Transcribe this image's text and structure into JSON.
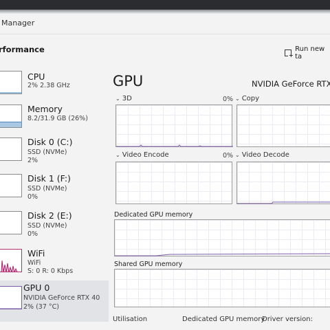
{
  "window": {
    "title": "Manager"
  },
  "header": {
    "section": "rformance",
    "run_new_task": "Run new ta"
  },
  "sidebar": {
    "items": [
      {
        "name": "CPU",
        "line2": "2% 2.38 GHz",
        "line3": ""
      },
      {
        "name": "Memory",
        "line2": "8.2/31.9 GB (26%)",
        "line3": ""
      },
      {
        "name": "Disk 0 (C:)",
        "line2": "SSD (NVMe)",
        "line3": "2%"
      },
      {
        "name": "Disk 1 (F:)",
        "line2": "SSD (NVMe)",
        "line3": "0%"
      },
      {
        "name": "Disk 2 (E:)",
        "line2": "SSD (NVMe)",
        "line3": "0%"
      },
      {
        "name": "WiFi",
        "line2": "WiFi",
        "line3": "S: 0 R: 0 Kbps"
      },
      {
        "name": "GPU 0",
        "line2": "NVIDIA GeForce RTX 40",
        "line3": "2% (37 °C)"
      }
    ]
  },
  "main": {
    "title": "GPU",
    "model": "NVIDIA GeForce RTX",
    "engines": [
      {
        "label": "3D",
        "percent": "0%"
      },
      {
        "label": "Copy",
        "percent": ""
      },
      {
        "label": "Video Encode",
        "percent": "0%"
      },
      {
        "label": "Video Decode",
        "percent": ""
      }
    ],
    "dedicated_memory_label": "Dedicated GPU memory",
    "shared_memory_label": "Shared GPU memory",
    "stats": {
      "utilisation": "Utilisation",
      "dedicated": "Dedicated GPU memory",
      "driver": "Driver version:"
    }
  },
  "colors": {
    "gpu_line": "#7a5aa8",
    "memory_fill": "#a9c8e4",
    "wifi_line": "#a0226a",
    "grid": "#ecebf1"
  }
}
